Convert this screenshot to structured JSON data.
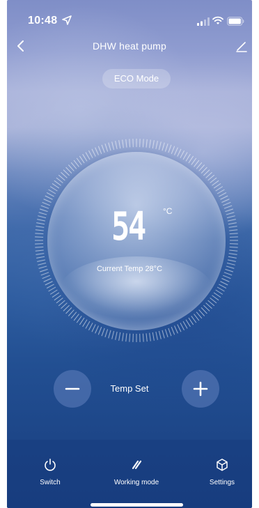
{
  "status_bar": {
    "time": "10:48",
    "icons": [
      "location-arrow-icon",
      "signal-icon",
      "wifi-icon",
      "battery-icon"
    ]
  },
  "header": {
    "title": "DHW heat pump",
    "back_icon": "chevron-left-icon",
    "edit_icon": "pencil-icon"
  },
  "mode": {
    "label": "ECO Mode"
  },
  "dial": {
    "set_temperature": "54",
    "unit": "°C",
    "current_temp_text": "Current Temp 28°C"
  },
  "temp_controls": {
    "label": "Temp Set",
    "decrease_icon": "minus-icon",
    "increase_icon": "plus-icon"
  },
  "bottom_tabs": [
    {
      "label": "Switch",
      "icon": "power-icon"
    },
    {
      "label": "Working mode",
      "icon": "double-slash-icon"
    },
    {
      "label": "Settings",
      "icon": "cube-icon"
    }
  ],
  "colors": {
    "accent": "#ffffff",
    "background_top": "#7f8ec7",
    "background_bottom": "#1a4082",
    "button_fill": "#6e8cc8"
  }
}
